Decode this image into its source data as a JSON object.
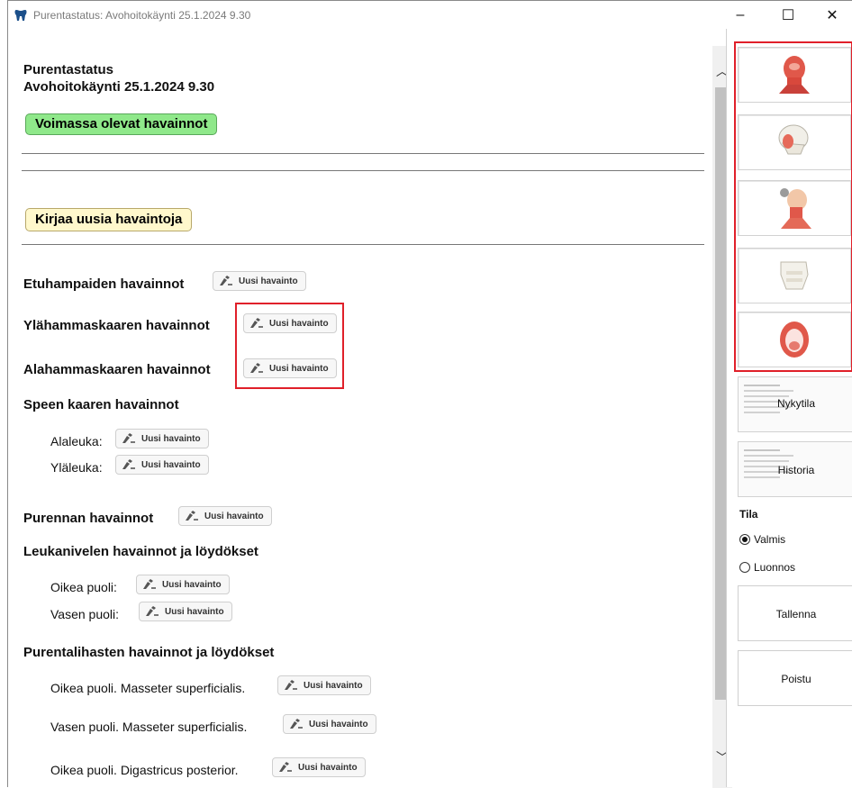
{
  "window": {
    "title": "Purentastatus: Avohoitokäynti 25.1.2024 9.30",
    "minimize": "–",
    "maximize": "☐",
    "close": "✕"
  },
  "header": {
    "line1": "Purentastatus",
    "line2": "Avohoitokäynti 25.1.2024 9.30"
  },
  "buttons": {
    "voimassa": "Voimassa olevat havainnot",
    "kirjaa": "Kirjaa uusia havaintoja",
    "uusi": "Uusi havainto"
  },
  "sections": {
    "etuhampaat": "Etuhampaiden havainnot",
    "ylahammaskaari": "Ylähammaskaaren havainnot",
    "alahammaskaari": "Alahammaskaaren havainnot",
    "speen": "Speen kaaren havainnot",
    "alaleuka": "Alaleuka:",
    "ylaleuka": "Yläleuka:",
    "purenta": "Purennan havainnot",
    "leukanivel": "Leukanivelen havainnot ja löydökset",
    "oikea": "Oikea puoli:",
    "vasen": "Vasen puoli:",
    "purentalihas": "Purentalihasten havainnot ja löydökset",
    "m1": "Oikea puoli. Masseter superficialis.",
    "m2": "Vasen puoli. Masseter superficialis.",
    "m3": "Oikea puoli. Digastricus posterior."
  },
  "right_panel": {
    "image_buttons": [
      "head-muscles-icon",
      "skull-side-icon",
      "neck-muscles-icon",
      "jaw-bones-icon",
      "open-mouth-icon"
    ],
    "nykytila": "Nykytila",
    "historia": "Historia",
    "tila_label": "Tila",
    "radio_valmis": "Valmis",
    "radio_luonnos": "Luonnos",
    "selected": "Valmis",
    "tallenna": "Tallenna",
    "poistu": "Poistu"
  },
  "colors": {
    "green_button": "#8fe88a",
    "yellow_button": "#fff8cc",
    "highlight": "#e0202a"
  }
}
